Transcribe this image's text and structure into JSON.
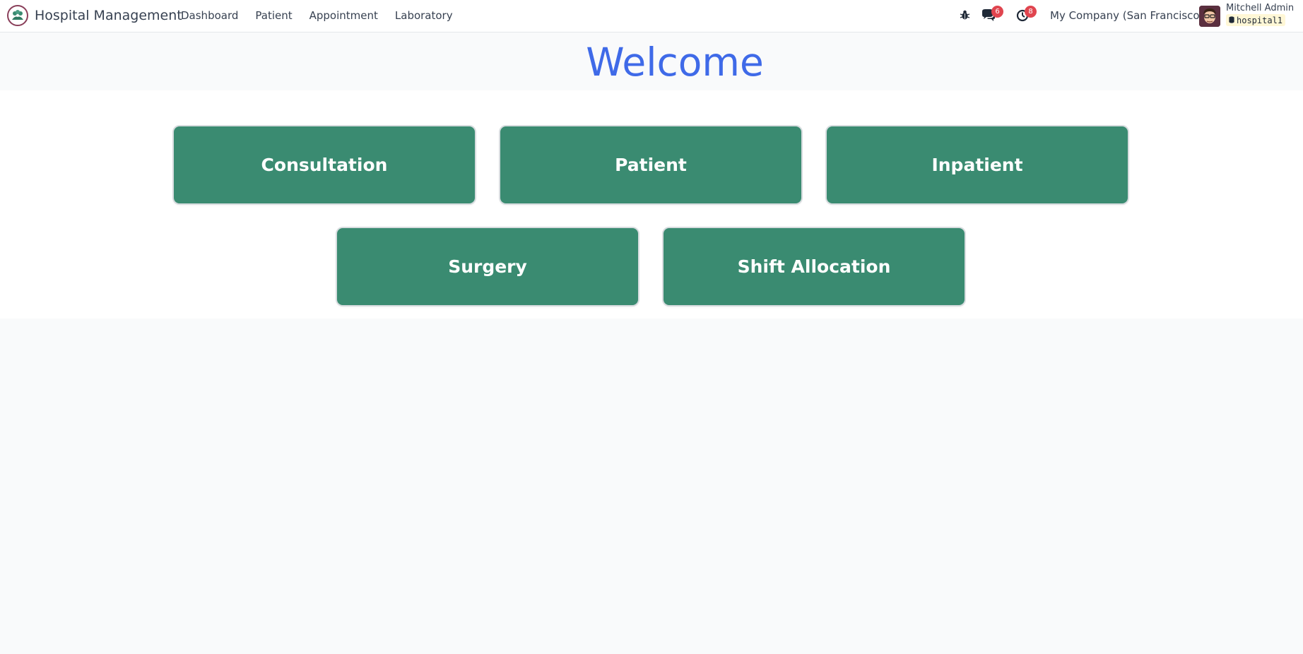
{
  "navbar": {
    "app_title": "Hospital Management",
    "menu": [
      "Dashboard",
      "Patient",
      "Appointment",
      "Laboratory"
    ],
    "messages_count": "6",
    "activities_count": "8",
    "company": "My Company (San Francisco)",
    "user_name": "Mitchell Admin",
    "database": "hospital1"
  },
  "welcome": {
    "title": "Welcome"
  },
  "tiles": [
    "Consultation",
    "Patient",
    "Inpatient",
    "Surgery",
    "Shift Allocation"
  ],
  "colors": {
    "tile_bg": "#3a8b71",
    "welcome_text": "#3f6ae8",
    "badge": "#e0454f"
  }
}
